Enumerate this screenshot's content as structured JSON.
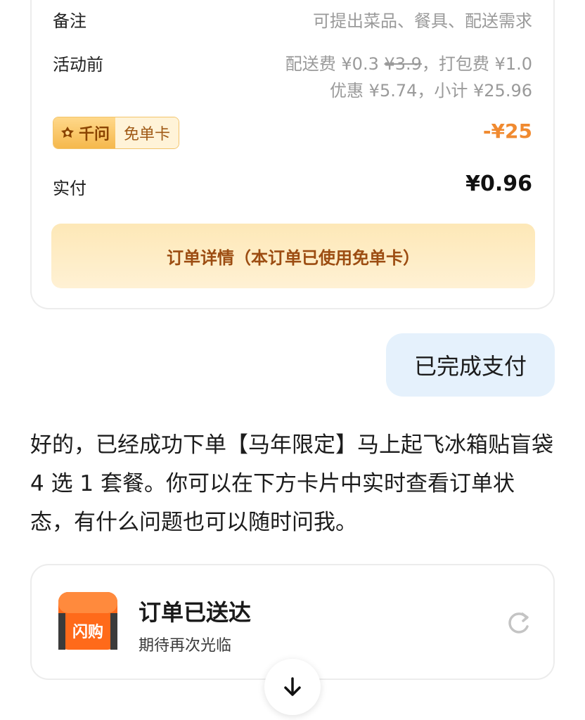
{
  "order": {
    "note_label": "备注",
    "note_placeholder": "可提出菜品、餐具、配送需求",
    "promo_label": "活动前",
    "promo_line1_prefix": "配送费 ¥0.3 ",
    "promo_line1_strike": "¥3.9",
    "promo_line1_suffix": "，打包费 ¥1.0",
    "promo_line2": "优惠 ¥5.74，小计 ¥25.96",
    "coupon_brand": "千问",
    "coupon_name": "免单卡",
    "coupon_discount": "-¥25",
    "paid_label": "实付",
    "paid_amount": "¥0.96",
    "detail_button": "订单详情（本订单已使用免单卡）"
  },
  "chat": {
    "user_message": "已完成支付",
    "assistant_reply": "好的，已经成功下单【马年限定】马上起飞冰箱贴盲袋 4 选 1 套餐。你可以在下方卡片中实时查看订单状态，有什么问题也可以随时问我。"
  },
  "status_card": {
    "logo_text": "闪购",
    "title": "订单已送达",
    "subtitle": "期待再次光临",
    "logo_icon": "orange-delivery-box-icon",
    "refresh_icon": "refresh-icon"
  },
  "scroll_button": {
    "icon": "arrow-down-icon"
  },
  "colors": {
    "accent_orange": "#f08a30",
    "detail_text": "#9c4d12",
    "user_bubble": "#e5f1fc",
    "coupon_border": "#f3c46a"
  }
}
